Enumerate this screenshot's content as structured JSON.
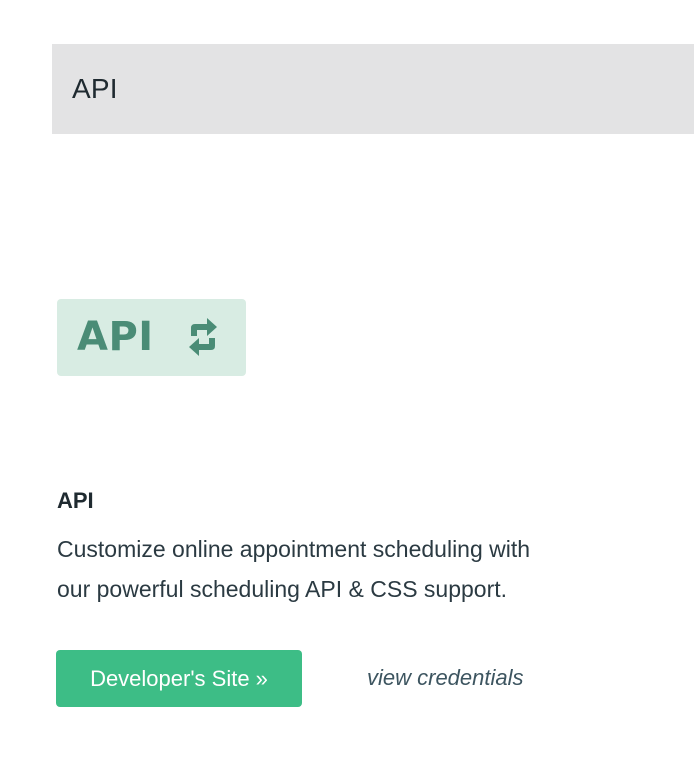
{
  "header": {
    "title": "API"
  },
  "integration": {
    "logo_text": "API",
    "logo_icon": "sync-arrows-icon",
    "title": "API",
    "description_line1": "Customize online appointment scheduling with",
    "description_line2": "our powerful scheduling API & CSS support.",
    "primary_button_label": "Developer's Site »",
    "secondary_link_label": "view credentials"
  },
  "colors": {
    "header_bg": "#e3e3e4",
    "logo_bg": "#d8ece3",
    "logo_fg": "#4a8c76",
    "button_bg": "#3dbd86",
    "button_text": "#ffffff",
    "link_text": "#3d5560"
  }
}
